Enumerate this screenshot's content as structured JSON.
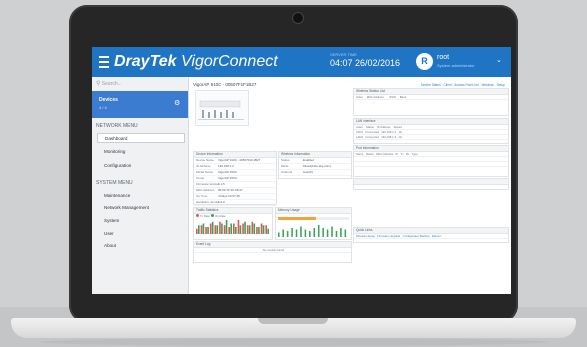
{
  "header": {
    "brand_main": "DrayTek",
    "brand_sub": "VigorConnect",
    "datetime_label": "SERVER TIME",
    "datetime_value": "04:07 26/02/2016",
    "avatar_initial": "R",
    "user_name": "root",
    "user_role": "System administrator"
  },
  "sidebar": {
    "search_placeholder": "Search...",
    "device_card": {
      "name": "Devices",
      "count": "4 / 4"
    },
    "network_menu_title": "NETWORK MENU",
    "network_items": [
      "Dashboard",
      "Monitoring",
      "Configuration"
    ],
    "system_menu_title": "SYSTEM MENU",
    "system_items": [
      "Maintenance",
      "Network Management",
      "System",
      "User",
      "About"
    ]
  },
  "main": {
    "title": "VigorAP 910C - 00507F1F1B27",
    "toolbar_links": "Device Status  ·  Client  ·  Access Point List  ·  Wireless  ·  Setup",
    "device_info": {
      "title": "Device Information",
      "rows": [
        {
          "k": "Device Name",
          "v": "VigorAP 910C - 00507F1F1B27"
        },
        {
          "k": "IP Address",
          "v": "192.168.1.2"
        },
        {
          "k": "Model Name",
          "v": "VigorAP 910C"
        },
        {
          "k": "Group",
          "v": "VigorAP 910C"
        },
        {
          "k": "Firmware Version",
          "v": "1.1.5"
        },
        {
          "k": "MAC Address",
          "v": "00:50:7F:1F:1B:27"
        },
        {
          "k": "Up Time",
          "v": "4 Days 04:07:45"
        },
        {
          "k": "Hardware Version",
          "v": "1.0.0"
        }
      ]
    },
    "wireless_info": {
      "title": "Wireless Information",
      "rows": [
        {
          "k": "Status",
          "v": "Enabled"
        },
        {
          "k": "Mode",
          "v": "Mixed(11b+11g+11n)"
        },
        {
          "k": "Channel",
          "v": "Auto(6)"
        }
      ]
    },
    "station_list": {
      "title": "Wireless Station List",
      "cols": [
        "Index",
        "MAC Address",
        "SSID",
        "Band"
      ]
    },
    "lan_info": {
      "title": "LAN Interface",
      "cols": [
        "Index",
        "Status",
        "IP Address",
        "Speed"
      ],
      "rows": [
        [
          "LAN1",
          "Connected",
          "192.168.1.2",
          "1G"
        ],
        [
          "LAN2",
          "Connected",
          "192.168.1.3",
          "1G"
        ]
      ]
    },
    "port_info": {
      "title": "Port Information",
      "cols": [
        "Name",
        "Status",
        "MAC Address",
        "IP",
        "Tx",
        "Rx",
        "Type"
      ]
    },
    "traffic": {
      "title": "Traffic Statistics",
      "legend_tx": "Tx Rate",
      "legend_rx": "Rx Rate"
    },
    "memory": {
      "title": "Memory Usage",
      "percent": 53
    },
    "event_log": {
      "title": "Event Log",
      "empty": "No records found"
    },
    "quick_links": {
      "title": "Quick Links",
      "items": [
        "Wireless Setup",
        "Firmware Upgrade",
        "Configuration Backup",
        "Reboot"
      ]
    },
    "sparkline_levels": [
      3,
      5,
      4,
      6,
      5,
      7,
      5,
      4,
      6,
      8,
      6,
      5,
      7,
      4,
      6,
      5
    ]
  },
  "colors": {
    "accent": "#1f74c4",
    "sidebar_active": "#3b7bd0"
  }
}
